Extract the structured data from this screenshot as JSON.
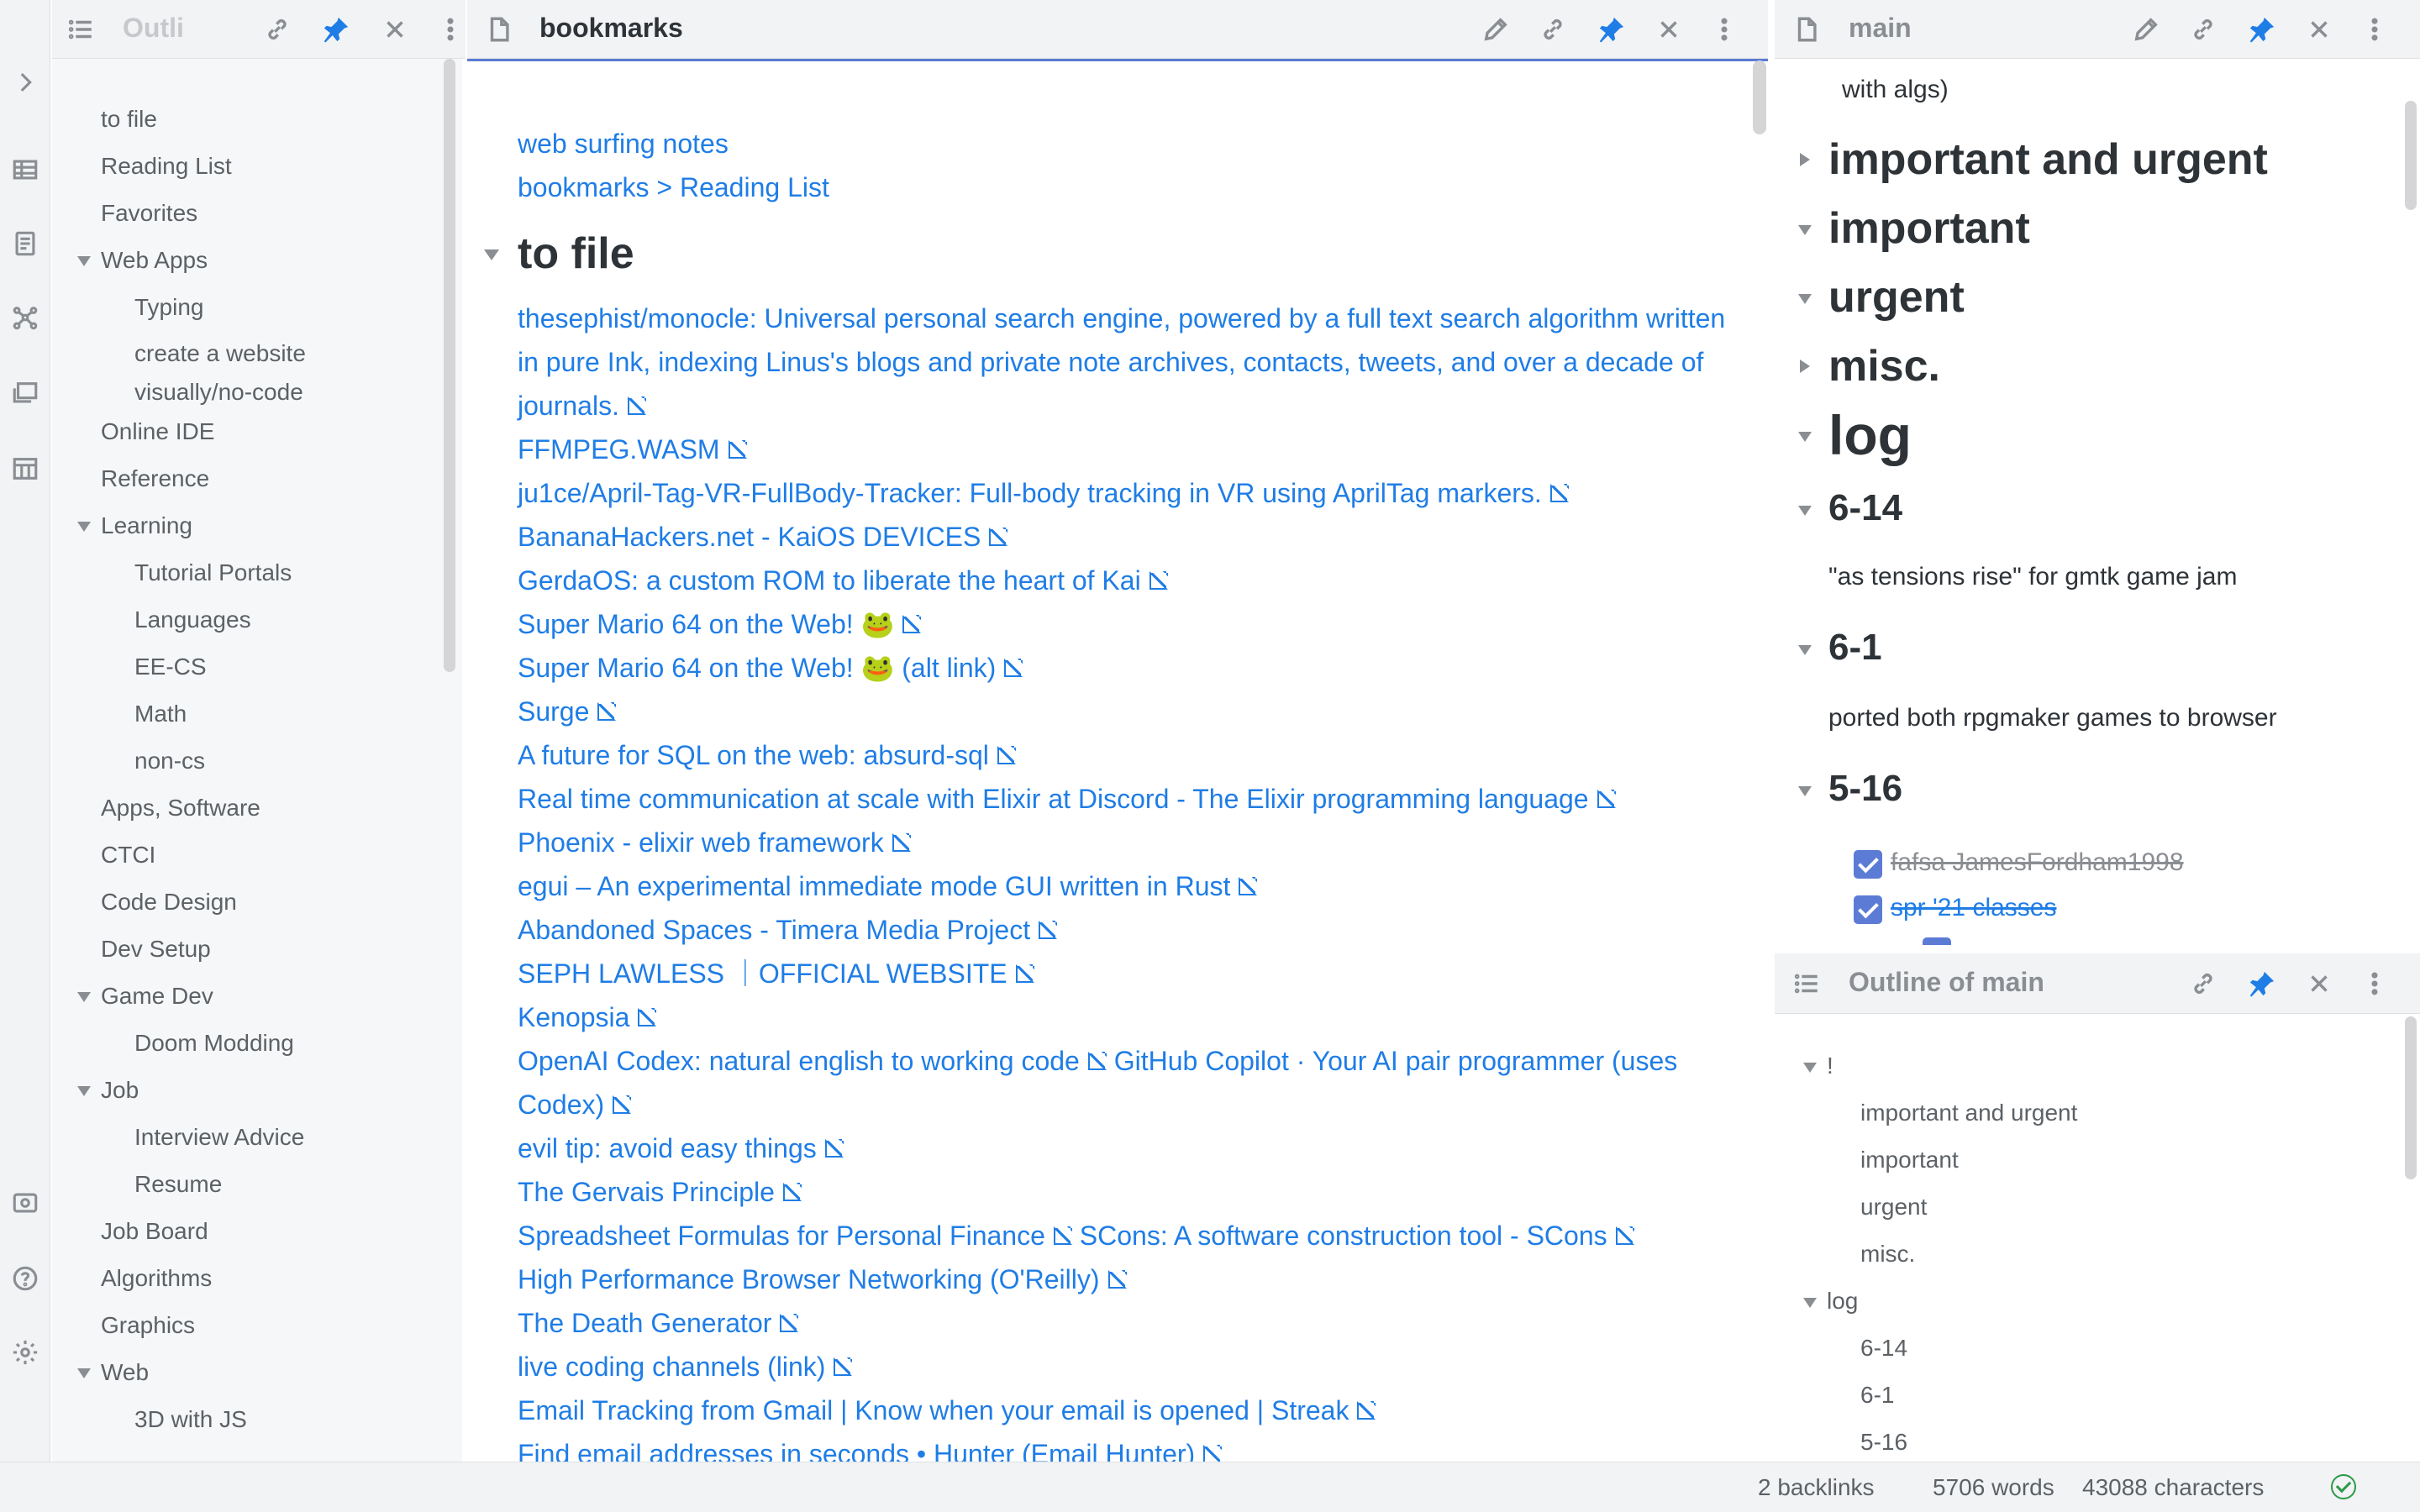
{
  "left_outline": {
    "header_title": "Outli",
    "items": [
      {
        "label": "to file",
        "level": 1
      },
      {
        "label": "Reading List",
        "level": 1
      },
      {
        "label": "Favorites",
        "level": 1
      },
      {
        "label": "Web Apps",
        "level": 1,
        "expanded": true
      },
      {
        "label": "Typing",
        "level": 2
      },
      {
        "label": "create a website visually/no-code",
        "level": 2,
        "wrap": true
      },
      {
        "label": "Online IDE",
        "level": 1
      },
      {
        "label": "Reference",
        "level": 1
      },
      {
        "label": "Learning",
        "level": 1,
        "expanded": true
      },
      {
        "label": "Tutorial Portals",
        "level": 2
      },
      {
        "label": "Languages",
        "level": 2
      },
      {
        "label": "EE-CS",
        "level": 2
      },
      {
        "label": "Math",
        "level": 2
      },
      {
        "label": "non-cs",
        "level": 2
      },
      {
        "label": "Apps, Software",
        "level": 1
      },
      {
        "label": "CTCI",
        "level": 1
      },
      {
        "label": "Code Design",
        "level": 1
      },
      {
        "label": "Dev Setup",
        "level": 1
      },
      {
        "label": "Game Dev",
        "level": 1,
        "expanded": true
      },
      {
        "label": "Doom Modding",
        "level": 2
      },
      {
        "label": "Job",
        "level": 1,
        "expanded": true
      },
      {
        "label": "Interview Advice",
        "level": 2
      },
      {
        "label": "Resume",
        "level": 2
      },
      {
        "label": "Job Board",
        "level": 1
      },
      {
        "label": "Algorithms",
        "level": 1
      },
      {
        "label": "Graphics",
        "level": 1
      },
      {
        "label": "Web",
        "level": 1,
        "expanded": true
      },
      {
        "label": "3D with JS",
        "level": 2
      }
    ]
  },
  "center": {
    "title": "bookmarks",
    "top_links": [
      "web surfing notes",
      "bookmarks > Reading List"
    ],
    "heading": "to file",
    "lines": [
      [
        {
          "t": "thesephist/monocle: Universal personal search engine, powered by a full text search algorithm written in pure Ink, indexing Linus's blogs and private note archives, contacts, tweets, and over a decade of journals.",
          "ext": true
        }
      ],
      [
        {
          "t": "FFMPEG.WASM",
          "ext": true
        }
      ],
      [
        {
          "t": "ju1ce/April-Tag-VR-FullBody-Tracker: Full-body tracking in VR using AprilTag markers.",
          "ext": true
        }
      ],
      [
        {
          "t": "BananaHackers.net - KaiOS DEVICES",
          "ext": true
        }
      ],
      [
        {
          "t": "GerdaOS: a custom ROM to liberate the heart of Kai",
          "ext": true
        }
      ],
      [
        {
          "t": "Super Mario 64 on the Web! 🐸",
          "ext": true
        }
      ],
      [
        {
          "t": "Super Mario 64 on the Web! 🐸 (alt link)",
          "ext": true
        }
      ],
      [
        {
          "t": "Surge",
          "ext": true
        }
      ],
      [
        {
          "t": "A future for SQL on the web: absurd-sql",
          "ext": true
        }
      ],
      [
        {
          "t": "Real time communication at scale with Elixir at Discord - The Elixir programming language",
          "ext": true
        }
      ],
      [
        {
          "t": "Phoenix - elixir web framework",
          "ext": true
        }
      ],
      [
        {
          "t": "egui – An experimental immediate mode GUI written in Rust",
          "ext": true
        }
      ],
      [
        {
          "t": "Abandoned Spaces - Timera Media Project",
          "ext": true
        }
      ],
      [
        {
          "t": "SEPH LAWLESS ｜OFFICIAL WEBSITE",
          "ext": true
        }
      ],
      [
        {
          "t": "Kenopsia",
          "ext": true
        }
      ],
      [
        {
          "t": "OpenAI Codex: natural english to working code",
          "ext": true
        },
        {
          "t": "GitHub Copilot · Your AI pair programmer (uses Codex)",
          "ext": true
        }
      ],
      [
        {
          "t": "evil tip: avoid easy things",
          "ext": true
        }
      ],
      [
        {
          "t": "The Gervais Principle",
          "ext": true
        }
      ],
      [
        {
          "t": "Spreadsheet Formulas for Personal Finance",
          "ext": true
        },
        {
          "t": "SCons: A software construction tool - SCons",
          "ext": true
        }
      ],
      [
        {
          "t": "High Performance Browser Networking (O'Reilly)",
          "ext": true
        }
      ],
      [
        {
          "t": "The Death Generator",
          "ext": true
        }
      ],
      [
        {
          "t": "live coding channels (link)",
          "ext": true
        }
      ],
      [
        {
          "t": "Email Tracking from Gmail | Know when your email is opened | Streak",
          "ext": true
        }
      ],
      [
        {
          "t": "Find email addresses in seconds • Hunter (Email Hunter)",
          "ext": true
        }
      ]
    ]
  },
  "right_top": {
    "title": "main",
    "partial_line": "with algs)",
    "headings": [
      {
        "label": "important and urgent",
        "collapsed": true
      },
      {
        "label": "important",
        "collapsed": false
      },
      {
        "label": "urgent",
        "collapsed": false
      },
      {
        "label": "misc.",
        "collapsed": true
      },
      {
        "label": "log",
        "collapsed": false
      },
      {
        "label": "6-14",
        "collapsed": false
      },
      {
        "label": "6-1",
        "collapsed": false
      },
      {
        "label": "5-16",
        "collapsed": false
      }
    ],
    "note_6_14": "\"as tensions rise\" for gmtk game jam",
    "note_6_1": "ported both rpgmaker games to browser",
    "todos": [
      {
        "label": "fafsa JamesFordham1998",
        "done": true,
        "link": false
      },
      {
        "label": "spr '21 classes",
        "done": true,
        "link": true
      }
    ]
  },
  "right_bottom": {
    "title": "Outline of main",
    "items": [
      {
        "label": "!",
        "level": 1,
        "expanded": true
      },
      {
        "label": "important and urgent",
        "level": 2
      },
      {
        "label": "important",
        "level": 2
      },
      {
        "label": "urgent",
        "level": 2
      },
      {
        "label": "misc.",
        "level": 2
      },
      {
        "label": "log",
        "level": 1,
        "expanded": true
      },
      {
        "label": "6-14",
        "level": 2
      },
      {
        "label": "6-1",
        "level": 2
      },
      {
        "label": "5-16",
        "level": 2
      }
    ]
  },
  "status_bar": {
    "backlinks": "2 backlinks",
    "words": "5706 words",
    "characters": "43088 characters"
  },
  "colors": {
    "link": "#1f7de6",
    "accent": "#5b7bd5",
    "pin": "#1f7de6",
    "sync_ok": "#2b9a46"
  }
}
